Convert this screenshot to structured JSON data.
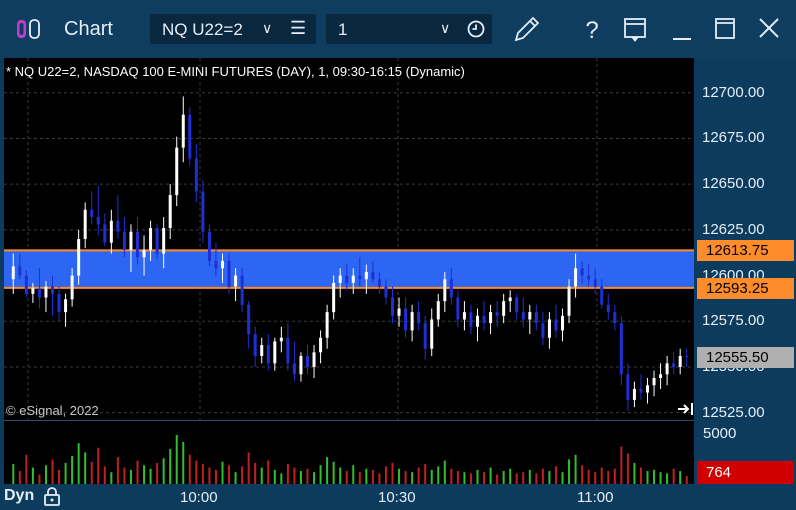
{
  "window": {
    "title": "Chart",
    "symbol": "NQ U22=2",
    "interval": "1"
  },
  "chart": {
    "header": "* NQ U22=2, NASDAQ 100 E-MINI FUTURES (DAY), 1, 09:30-16:15 (Dynamic)",
    "copyright": "© eSignal, 2022",
    "price_ticks": [
      "12700.00",
      "12675.00",
      "12650.00",
      "12625.00",
      "12600.00",
      "12575.00",
      "12550.00",
      "12525.00"
    ],
    "tags": {
      "zone_top": "12613.75",
      "zone_bottom": "12593.25",
      "last": "12555.50"
    },
    "volume_tick": "5000",
    "volume_last": "764",
    "time_labels": [
      "10:00",
      "10:30",
      "11:00"
    ],
    "mode_label": "Dyn",
    "colors": {
      "zone_fill": "#2f6bff",
      "zone_line": "#ff8c2a",
      "up_candle": "#ffffff",
      "down_candle": "#1f2fd6",
      "last_tag": "#b0b0b0",
      "volume_tag": "#d10000"
    }
  },
  "chart_data": {
    "type": "candlestick",
    "y_range": [
      12521,
      12719
    ],
    "candles_ohlc": [
      [
        12598,
        12612,
        12590,
        12605
      ],
      [
        12605,
        12612,
        12598,
        12600
      ],
      [
        12600,
        12603,
        12588,
        12590
      ],
      [
        12590,
        12596,
        12585,
        12593
      ],
      [
        12593,
        12604,
        12582,
        12588
      ],
      [
        12588,
        12597,
        12580,
        12594
      ],
      [
        12594,
        12600,
        12578,
        12590
      ],
      [
        12590,
        12594,
        12575,
        12580
      ],
      [
        12580,
        12590,
        12572,
        12587
      ],
      [
        12587,
        12604,
        12583,
        12600
      ],
      [
        12600,
        12625,
        12595,
        12620
      ],
      [
        12620,
        12640,
        12615,
        12636
      ],
      [
        12636,
        12646,
        12628,
        12632
      ],
      [
        12632,
        12649,
        12622,
        12628
      ],
      [
        12628,
        12634,
        12616,
        12618
      ],
      [
        12618,
        12636,
        12612,
        12630
      ],
      [
        12630,
        12644,
        12620,
        12624
      ],
      [
        12624,
        12632,
        12610,
        12614
      ],
      [
        12614,
        12628,
        12602,
        12624
      ],
      [
        12624,
        12632,
        12606,
        12610
      ],
      [
        12610,
        12622,
        12600,
        12614
      ],
      [
        12614,
        12630,
        12608,
        12626
      ],
      [
        12626,
        12628,
        12609,
        12612
      ],
      [
        12612,
        12632,
        12604,
        12626
      ],
      [
        12626,
        12650,
        12620,
        12644
      ],
      [
        12644,
        12676,
        12638,
        12670
      ],
      [
        12670,
        12698,
        12662,
        12688
      ],
      [
        12688,
        12692,
        12660,
        12664
      ],
      [
        12664,
        12672,
        12640,
        12646
      ],
      [
        12646,
        12652,
        12618,
        12624
      ],
      [
        12624,
        12628,
        12605,
        12608
      ],
      [
        12608,
        12618,
        12600,
        12604
      ],
      [
        12604,
        12612,
        12596,
        12608
      ],
      [
        12608,
        12612,
        12590,
        12594
      ],
      [
        12594,
        12604,
        12586,
        12600
      ],
      [
        12600,
        12604,
        12580,
        12584
      ],
      [
        12584,
        12586,
        12560,
        12568
      ],
      [
        12568,
        12572,
        12550,
        12556
      ],
      [
        12556,
        12566,
        12552,
        12562
      ],
      [
        12562,
        12568,
        12548,
        12552
      ],
      [
        12552,
        12566,
        12548,
        12564
      ],
      [
        12564,
        12572,
        12558,
        12566
      ],
      [
        12566,
        12574,
        12548,
        12552
      ],
      [
        12552,
        12564,
        12542,
        12546
      ],
      [
        12546,
        12558,
        12542,
        12556
      ],
      [
        12556,
        12562,
        12546,
        12550
      ],
      [
        12550,
        12562,
        12544,
        12558
      ],
      [
        12558,
        12570,
        12552,
        12566
      ],
      [
        12566,
        12584,
        12560,
        12580
      ],
      [
        12580,
        12600,
        12576,
        12596
      ],
      [
        12596,
        12604,
        12588,
        12600
      ],
      [
        12600,
        12606,
        12592,
        12596
      ],
      [
        12596,
        12604,
        12590,
        12600
      ],
      [
        12600,
        12610,
        12594,
        12598
      ],
      [
        12598,
        12606,
        12590,
        12602
      ],
      [
        12602,
        12608,
        12596,
        12598
      ],
      [
        12598,
        12602,
        12590,
        12594
      ],
      [
        12594,
        12598,
        12584,
        12588
      ],
      [
        12588,
        12594,
        12574,
        12578
      ],
      [
        12578,
        12588,
        12572,
        12582
      ],
      [
        12582,
        12588,
        12566,
        12570
      ],
      [
        12570,
        12584,
        12564,
        12580
      ],
      [
        12580,
        12586,
        12570,
        12574
      ],
      [
        12574,
        12578,
        12554,
        12560
      ],
      [
        12560,
        12582,
        12556,
        12576
      ],
      [
        12576,
        12590,
        12572,
        12586
      ],
      [
        12586,
        12602,
        12580,
        12598
      ],
      [
        12598,
        12604,
        12584,
        12588
      ],
      [
        12588,
        12592,
        12572,
        12576
      ],
      [
        12576,
        12586,
        12570,
        12580
      ],
      [
        12580,
        12584,
        12568,
        12572
      ],
      [
        12572,
        12582,
        12564,
        12578
      ],
      [
        12578,
        12586,
        12570,
        12574
      ],
      [
        12574,
        12584,
        12568,
        12580
      ],
      [
        12580,
        12586,
        12572,
        12578
      ],
      [
        12578,
        12590,
        12574,
        12586
      ],
      [
        12586,
        12592,
        12580,
        12588
      ],
      [
        12588,
        12590,
        12576,
        12580
      ],
      [
        12580,
        12588,
        12572,
        12576
      ],
      [
        12576,
        12584,
        12568,
        12580
      ],
      [
        12580,
        12584,
        12570,
        12574
      ],
      [
        12574,
        12580,
        12562,
        12566
      ],
      [
        12566,
        12580,
        12560,
        12576
      ],
      [
        12576,
        12584,
        12566,
        12570
      ],
      [
        12570,
        12582,
        12564,
        12578
      ],
      [
        12578,
        12598,
        12574,
        12594
      ],
      [
        12594,
        12612,
        12588,
        12604
      ],
      [
        12604,
        12608,
        12596,
        12600
      ],
      [
        12600,
        12606,
        12594,
        12598
      ],
      [
        12598,
        12604,
        12590,
        12594
      ],
      [
        12594,
        12598,
        12582,
        12584
      ],
      [
        12584,
        12590,
        12576,
        12580
      ],
      [
        12580,
        12584,
        12570,
        12574
      ],
      [
        12574,
        12578,
        12540,
        12546
      ],
      [
        12546,
        12552,
        12526,
        12532
      ],
      [
        12532,
        12542,
        12528,
        12538
      ],
      [
        12538,
        12546,
        12532,
        12536
      ],
      [
        12536,
        12544,
        12530,
        12540
      ],
      [
        12540,
        12548,
        12534,
        12544
      ],
      [
        12544,
        12552,
        12538,
        12546
      ],
      [
        12546,
        12556,
        12540,
        12552
      ],
      [
        12552,
        12558,
        12546,
        12550
      ],
      [
        12550,
        12560,
        12546,
        12556
      ],
      [
        12556,
        12560,
        12550,
        12555.5
      ]
    ],
    "volume": [
      1800,
      1200,
      2600,
      1500,
      900,
      1700,
      2200,
      1300,
      1900,
      2500,
      3600,
      2800,
      2000,
      3200,
      1600,
      1100,
      2400,
      1500,
      1300,
      2100,
      1700,
      1400,
      1900,
      2300,
      3100,
      4300,
      3700,
      2600,
      2100,
      1800,
      1500,
      1300,
      2000,
      1700,
      1100,
      1600,
      2800,
      1900,
      1500,
      2100,
      1300,
      1000,
      1800,
      1500,
      1200,
      1400,
      1100,
      1700,
      2400,
      2000,
      1500,
      1200,
      1700,
      1100,
      1400,
      1300,
      1000,
      1600,
      1900,
      1400,
      1200,
      1100,
      1500,
      1800,
      1300,
      1600,
      2100,
      1400,
      1200,
      1100,
      1000,
      1300,
      1100,
      1500,
      900,
      1200,
      1400,
      1000,
      1100,
      1300,
      1000,
      1400,
      1200,
      1600,
      1100,
      2200,
      2600,
      1700,
      1300,
      1100,
      1500,
      1200,
      1400,
      3300,
      2700,
      1900,
      1500,
      1200,
      1300,
      1100,
      1000,
      1400,
      1200,
      764
    ],
    "volume_range": [
      0,
      5500
    ],
    "zone": [
      12593.25,
      12613.75
    ]
  }
}
